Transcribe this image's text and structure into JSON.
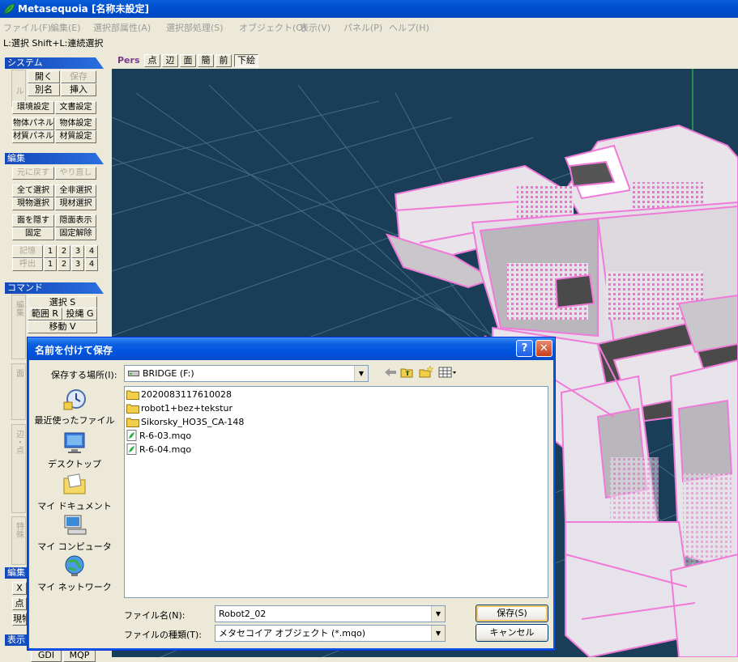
{
  "app": {
    "title": "Metasequoia [名称未設定]",
    "icon": "leaf-icon"
  },
  "menu": [
    "ファイル(F)",
    "編集(E)",
    "選択部属性(A)",
    "選択部処理(S)",
    "オブジェクト(O)",
    "表示(V)",
    "パネル(P)",
    "ヘルプ(H)"
  ],
  "status_hint": "L:選択  Shift+L:連続選択",
  "left_panel": {
    "system": {
      "header": "システム",
      "vtab": "ファイル",
      "open": "開く",
      "save": "保存",
      "save_as": "別名",
      "insert": "挿入",
      "env_settings": "環境設定",
      "doc_settings": "文書設定",
      "obj_panel": "物体パネル",
      "obj_settings": "物体設定",
      "mat_panel": "材質パネル",
      "mat_settings": "材質設定"
    },
    "edit": {
      "header": "編集",
      "undo": "元に戻す",
      "redo": "やり直し",
      "select_all": "全て選択",
      "deselect_all": "全非選択",
      "current_obj_select": "現物選択",
      "current_mat_select": "現材選択",
      "hide_faces": "面を隠す",
      "show_hidden": "隠面表示",
      "lock": "固定",
      "unlock": "固定解除",
      "memory": "記憶",
      "recall": "呼出",
      "slots": [
        "1",
        "2",
        "3",
        "4"
      ]
    },
    "command": {
      "header": "コマンド",
      "vtab_edit": "編集",
      "vtab_face": "面",
      "vtab_edge_point": "辺・点",
      "vtab_special": "特殊",
      "select": "選択 S",
      "range": "範囲 R",
      "lasso": "投縄 G",
      "move": "移動 V"
    },
    "display": {
      "header_edit": "編集",
      "header_display": "表示",
      "x_label": "X",
      "point_label": "点",
      "current_label": "現物",
      "gdi_tab": "GDI",
      "mqp_tab": "MQP"
    }
  },
  "view_toolbar": {
    "mode": "Pers",
    "buttons": [
      "点",
      "辺",
      "面",
      "簡",
      "前"
    ],
    "wire": "下絵"
  },
  "dialog": {
    "title": "名前を付けて保存",
    "help_glyph": "?",
    "close_glyph": "✕",
    "location_label": "保存する場所(I):",
    "location_value": "BRIDGE (F:)",
    "places": [
      "最近使ったファイル",
      "デスクトップ",
      "マイ ドキュメント",
      "マイ コンピュータ",
      "マイ ネットワーク"
    ],
    "files": [
      {
        "name": "2020083117610028",
        "type": "folder"
      },
      {
        "name": "robot1+bez+tekstur",
        "type": "folder"
      },
      {
        "name": "Sikorsky_HO3S_CA-148",
        "type": "folder"
      },
      {
        "name": "R-6-03.mqo",
        "type": "mqo"
      },
      {
        "name": "R-6-04.mqo",
        "type": "mqo"
      }
    ],
    "filename_label": "ファイル名(N):",
    "filename_value": "Robot2_02",
    "filetype_label": "ファイルの種類(T):",
    "filetype_value": "メタセコイア オブジェクト (*.mqo)",
    "save_button": "保存(S)",
    "cancel_button": "キャンセル"
  },
  "colors": {
    "viewport_bg": "#1b3e58",
    "wire_pink": "#f07ad8",
    "grid": "#3f6e82",
    "axis_green": "#2fd84a",
    "xp_title_blue": "#0a5fe0"
  }
}
